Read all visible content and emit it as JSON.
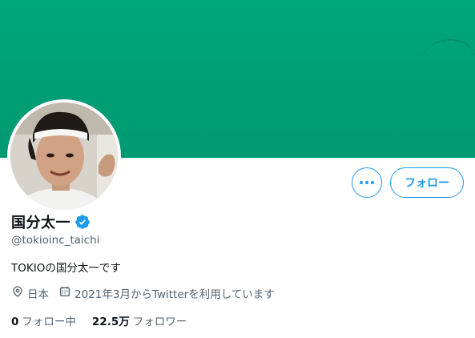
{
  "profile": {
    "display_name": "国分太一",
    "handle": "@tokioinc_taichi",
    "bio": "TOKIOの国分太一です",
    "location": "日本",
    "joined": "2021年3月からTwitterを利用しています",
    "verified": true
  },
  "actions": {
    "follow_label": "フォロー"
  },
  "stats": {
    "following_count": "0",
    "following_label": "フォロー中",
    "followers_count": "22.5万",
    "followers_label": "フォロワー"
  },
  "icons": {
    "more": "more-dots-icon",
    "verified": "verified-badge-icon",
    "location": "location-pin-icon",
    "calendar": "calendar-icon"
  },
  "colors": {
    "banner": "#00a077",
    "accent": "#1d9bf0",
    "text_primary": "#0f1419",
    "text_secondary": "#536471"
  }
}
